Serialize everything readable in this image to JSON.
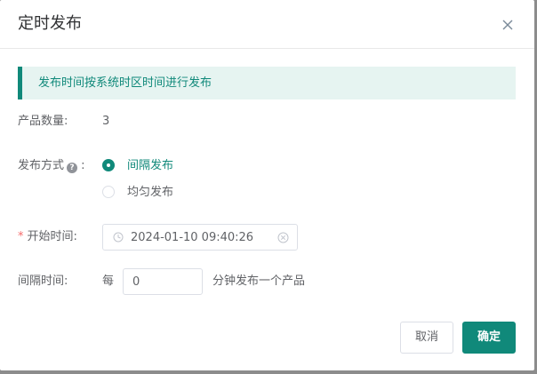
{
  "dialog": {
    "title": "定时发布",
    "close_icon": "close-icon",
    "accent_color": "#10897a"
  },
  "notice": {
    "text": "发布时间按系统时区时间进行发布"
  },
  "product_count": {
    "label": "产品数量:",
    "value": "3"
  },
  "publish_mode": {
    "label": "发布方式",
    "help_icon": "question-circle-icon",
    "help_glyph": "?",
    "colon": ":",
    "options": [
      {
        "label": "间隔发布",
        "checked": true
      },
      {
        "label": "均匀发布",
        "checked": false
      }
    ]
  },
  "start_time": {
    "required_mark": "*",
    "label": "开始时间:",
    "value": "2024-01-10 09:40:26",
    "clock_icon": "clock-icon",
    "clear_icon": "clear-circle-icon"
  },
  "interval": {
    "label": "间隔时间:",
    "prefix": "每",
    "value": "0",
    "suffix": "分钟发布一个产品"
  },
  "footer": {
    "cancel_label": "取消",
    "confirm_label": "确定"
  }
}
